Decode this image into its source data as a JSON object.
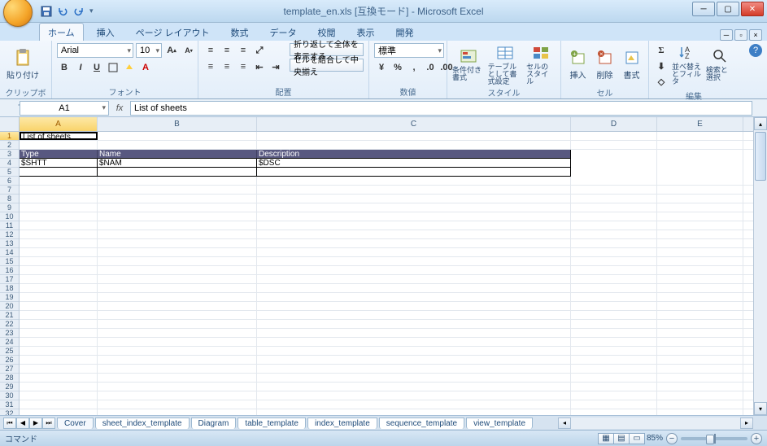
{
  "title": "template_en.xls [互換モード] - Microsoft Excel",
  "qat": {
    "save": "save",
    "undo": "undo",
    "redo": "redo"
  },
  "tabs": [
    "ホーム",
    "挿入",
    "ページ レイアウト",
    "数式",
    "データ",
    "校閲",
    "表示",
    "開発"
  ],
  "ribbon": {
    "clipboard": {
      "paste": "貼り付け",
      "label": "クリップボード"
    },
    "font": {
      "family": "Arial",
      "size": "10",
      "label": "フォント",
      "bold": "B",
      "italic": "I",
      "underline": "U"
    },
    "align": {
      "label": "配置",
      "wrap": "折り返して全体を表示する",
      "merge": "セルを結合して中央揃え"
    },
    "number": {
      "label": "数値",
      "format": "標準"
    },
    "styles": {
      "label": "スタイル",
      "cond": "条件付き書式",
      "table": "テーブルとして書式設定",
      "cell": "セルのスタイル"
    },
    "cells": {
      "label": "セル",
      "insert": "挿入",
      "delete": "削除",
      "format": "書式"
    },
    "editing": {
      "label": "編集",
      "sort": "並べ替えとフィルタ",
      "find": "検索と選択"
    }
  },
  "namebox": "A1",
  "formula": "List of sheets",
  "columns": [
    "A",
    "B",
    "C",
    "D",
    "E"
  ],
  "rows_count": 35,
  "cells": {
    "r1": {
      "A": "List of sheets"
    },
    "r3": {
      "A": "Type",
      "B": "Name",
      "C": "Description"
    },
    "r4": {
      "A": "$SHTT",
      "B": "$NAM",
      "C": "$DSC"
    }
  },
  "sheets": [
    "Cover",
    "sheet_index_template",
    "Diagram",
    "table_template",
    "index_template",
    "sequence_template",
    "view_template"
  ],
  "status": {
    "mode": "コマンド",
    "zoom": "85%"
  }
}
